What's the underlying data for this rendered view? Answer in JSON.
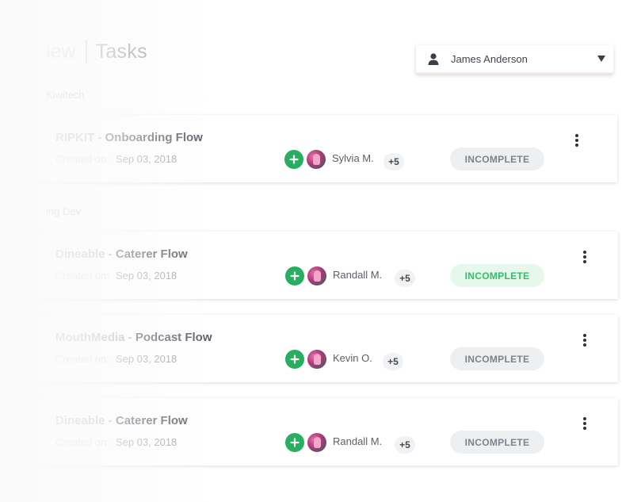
{
  "header": {
    "prev_crumb": "iew",
    "current": "Tasks"
  },
  "user_select": {
    "name": "James Anderson",
    "icon": "user-icon"
  },
  "groups": [
    {
      "label": "Kiwitech",
      "tasks": [
        {
          "project": "RIPKIT - ",
          "flow": "Onboarding Flow",
          "created_label": "Created on:",
          "created_date": "Sep 03, 2018",
          "assignee": "Sylvia M.",
          "more": "+5",
          "status": "INCOMPLETE"
        }
      ]
    },
    {
      "label": "ing Dev",
      "tasks": [
        {
          "project": "Dineable - ",
          "flow": "Caterer Flow",
          "created_label": "Created on:",
          "created_date": "Sep 03, 2018",
          "assignee": "Randall M.",
          "more": "+5",
          "status": "INCOMPLETE"
        },
        {
          "project": "MouthMedia - ",
          "flow": "Podcast Flow",
          "created_label": "Created on:",
          "created_date": "Sep 03, 2018",
          "assignee": "Kevin O.",
          "more": "+5",
          "status": "INCOMPLETE"
        },
        {
          "project": "Dineable - ",
          "flow": "Caterer Flow",
          "created_label": "Created on:",
          "created_date": "Sep 03, 2018",
          "assignee": "Randall M.",
          "more": "+5",
          "status": "INCOMPLETE"
        }
      ]
    }
  ],
  "colors": {
    "add_button": "#27ae60",
    "status_highlight_bg": "#e6f7ec",
    "status_highlight_text": "#2fbf6a",
    "status_default_bg": "#eeeff1"
  }
}
